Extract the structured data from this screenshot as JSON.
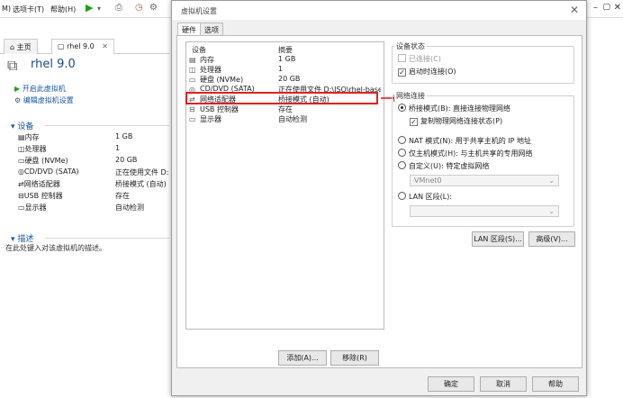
{
  "menubar": {
    "items": [
      "M)",
      "选项卡(T)",
      "帮助(H)"
    ]
  },
  "tabs": [
    {
      "label": "主页"
    },
    {
      "label": "rhel 9.0"
    }
  ],
  "vm": {
    "title": "rhel 9.0",
    "actions": [
      "开启此虚拟机",
      "编辑虚拟机设置"
    ],
    "devices_heading": "设备",
    "devices": [
      {
        "name": "内存",
        "value": "1 GB"
      },
      {
        "name": "处理器",
        "value": "1"
      },
      {
        "name": "硬盘 (NVMe)",
        "value": "20 GB"
      },
      {
        "name": "CD/DVD (SATA)",
        "value": "正在使用文件 D:..."
      },
      {
        "name": "网络适配器",
        "value": "桥接模式 (自动)"
      },
      {
        "name": "USB 控制器",
        "value": "存在"
      },
      {
        "name": "显示器",
        "value": "自动检测"
      }
    ],
    "desc_heading": "描述",
    "desc_placeholder": "在此处键入对该虚拟机的描述。"
  },
  "dialog": {
    "title": "虚拟机设置",
    "tabs": [
      "硬件",
      "选项"
    ],
    "list_headers": {
      "device": "设备",
      "summary": "摘要"
    },
    "devices": [
      {
        "name": "内存",
        "summary": "1 GB"
      },
      {
        "name": "处理器",
        "summary": "1"
      },
      {
        "name": "硬盘 (NVMe)",
        "summary": "20 GB"
      },
      {
        "name": "CD/DVD (SATA)",
        "summary": "正在使用文件 D:\\ISO\\rhel-base..."
      },
      {
        "name": "网络适配器",
        "summary": "桥接模式 (自动)"
      },
      {
        "name": "USB 控制器",
        "summary": "存在"
      },
      {
        "name": "显示器",
        "summary": "自动检测"
      }
    ],
    "selected_device": "网络适配器",
    "add_button": "添加(A)...",
    "remove_button": "移除(R)",
    "device_status": {
      "heading": "设备状态",
      "connected": "已连接(C)",
      "connect_at_power_on": "启动时连接(O)"
    },
    "network": {
      "heading": "网络连接",
      "bridged": "桥接模式(B): 直接连接物理网络",
      "replicate": "复制物理网络连接状态(P)",
      "nat": "NAT 模式(N): 用于共享主机的 IP 地址",
      "host_only": "仅主机模式(H): 与主机共享的专用网络",
      "custom": "自定义(U): 特定虚拟网络",
      "custom_value": "VMnet0",
      "lan_segment": "LAN 区段(L):",
      "lan_segment_value": "",
      "lan_button": "LAN 区段(S)...",
      "advanced_button": "高级(V)..."
    },
    "footer": {
      "ok": "确定",
      "cancel": "取消",
      "help": "帮助"
    }
  }
}
